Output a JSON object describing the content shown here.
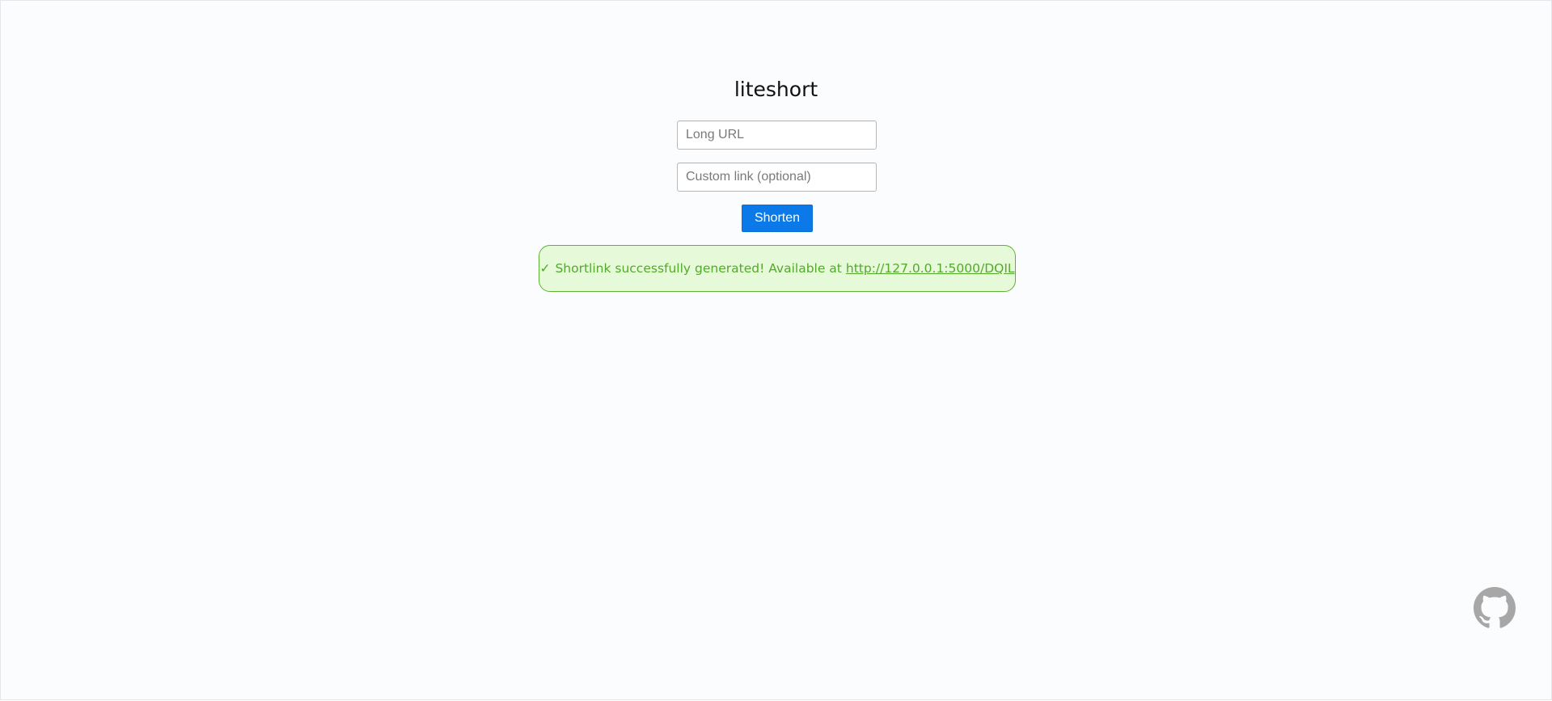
{
  "app": {
    "title": "liteshort"
  },
  "form": {
    "long_url": {
      "placeholder": "Long URL",
      "value": ""
    },
    "custom_link": {
      "placeholder": "Custom link (optional)",
      "value": ""
    },
    "submit_label": "Shorten"
  },
  "alert": {
    "icon": "✓",
    "message": "Shortlink successfully generated! Available at",
    "link_text": "http://127.0.0.1:5000/DQIL"
  },
  "footer": {
    "github_icon": "github-icon"
  },
  "colors": {
    "accent": "#0b7ae8",
    "success_text": "#53a92b",
    "success_bg": "#e6fad9",
    "success_border": "#5fb332",
    "github_icon": "#a7a7a7"
  }
}
